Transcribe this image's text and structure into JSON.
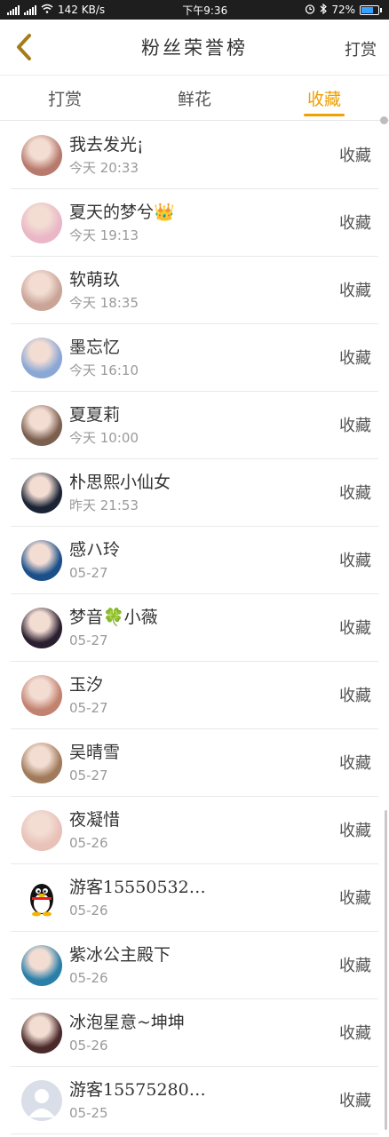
{
  "status_bar": {
    "left_text": "142 KB/s",
    "time": "下午9:36",
    "battery": "72%"
  },
  "header": {
    "title": "粉丝荣誉榜",
    "action_label": "打赏"
  },
  "tabs": [
    {
      "label": "打赏",
      "active": false
    },
    {
      "label": "鲜花",
      "active": false
    },
    {
      "label": "收藏",
      "active": true
    }
  ],
  "colors": {
    "accent": "#f0a000"
  },
  "list": {
    "action_label": "收藏",
    "items": [
      {
        "name": "我去发光¡",
        "time": "今天 20:33",
        "avatar": "#b77a6d"
      },
      {
        "name": "夏天的梦兮👑",
        "time": "今天 19:13",
        "avatar": "#e9b7c7"
      },
      {
        "name": "软萌玖",
        "time": "今天 18:35",
        "avatar": "#c9a497"
      },
      {
        "name": "墨忘忆",
        "time": "今天 16:10",
        "avatar": "#8aa7d6"
      },
      {
        "name": "夏夏莉",
        "time": "今天 10:00",
        "avatar": "#7b6050"
      },
      {
        "name": "朴思熙小仙女",
        "time": "昨天 21:53",
        "avatar": "#1a2435"
      },
      {
        "name": "感ハ玲",
        "time": "05-27",
        "avatar": "#1a4f8a"
      },
      {
        "name": "梦音🍀小薇",
        "time": "05-27",
        "avatar": "#2a1f30"
      },
      {
        "name": "玉汐",
        "time": "05-27",
        "avatar": "#c28270"
      },
      {
        "name": "吴晴雪",
        "time": "05-27",
        "avatar": "#a07a5a"
      },
      {
        "name": "夜凝惜",
        "time": "05-26",
        "avatar": "#e8c1b8"
      },
      {
        "name": "游客15550532…",
        "time": "05-26",
        "avatar": "qq"
      },
      {
        "name": "紫冰公主殿下",
        "time": "05-26",
        "avatar": "#2a7fa8"
      },
      {
        "name": "冰泡星意~坤坤",
        "time": "05-26",
        "avatar": "#4a2a2a"
      },
      {
        "name": "游客15575280…",
        "time": "05-25",
        "avatar": "default"
      }
    ]
  }
}
